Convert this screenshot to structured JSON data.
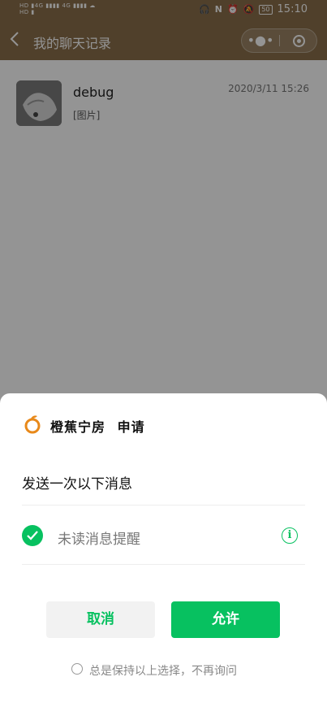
{
  "status_bar": {
    "left_text": "HD 4G 4G",
    "time": "15:10",
    "battery": "50"
  },
  "nav": {
    "title": "我的聊天记录",
    "back_icon": "chevron-left-icon",
    "more_icon": "more-dots-icon",
    "close_icon": "target-circle-icon"
  },
  "chat_list": [
    {
      "name": "debug",
      "preview": "[图片]",
      "time": "2020/3/11 15:26"
    }
  ],
  "dialog": {
    "app_name": "橙蕉宁房",
    "action": "申请",
    "description": "发送一次以下消息",
    "option_label": "未读消息提醒",
    "cancel_label": "取消",
    "allow_label": "允许",
    "remember_label": "总是保持以上选择，不再询问",
    "accent_color": "#07c160",
    "logo_color": "#e8891a"
  }
}
